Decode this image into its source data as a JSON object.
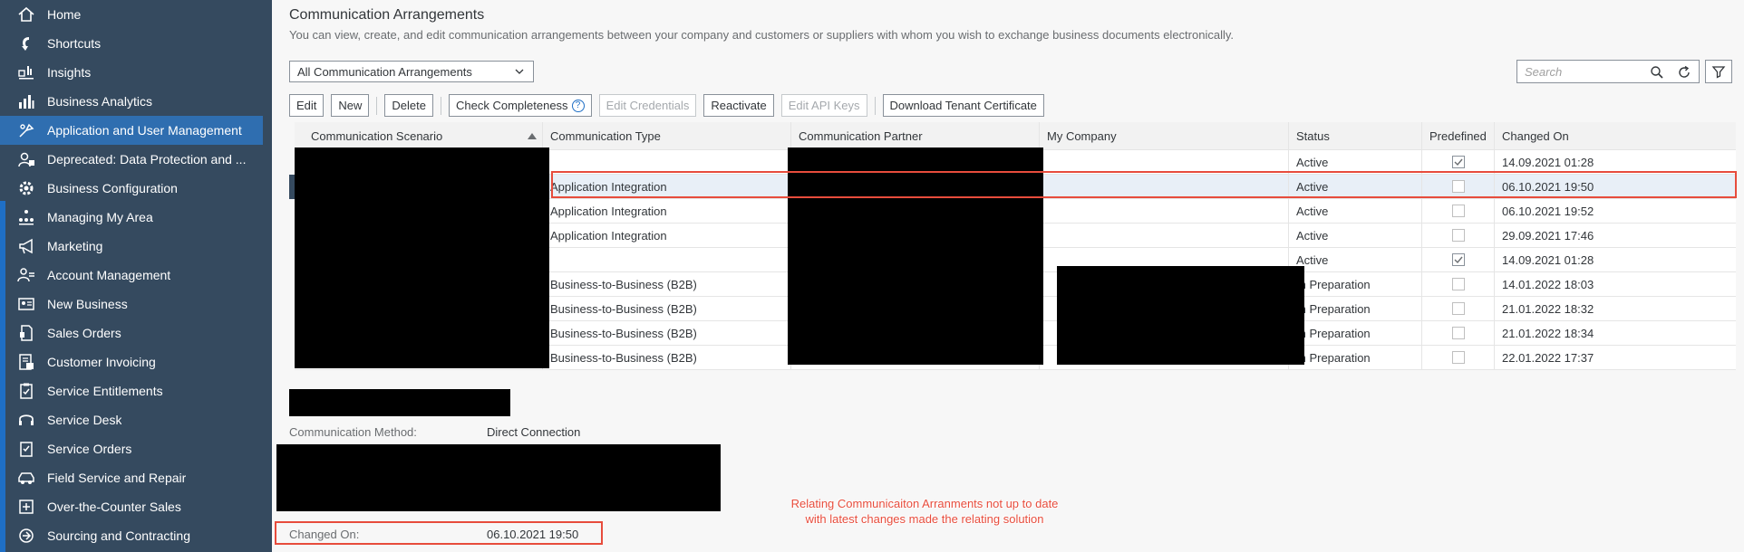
{
  "sidebar": {
    "items": [
      {
        "label": "Home",
        "icon": "home-icon"
      },
      {
        "label": "Shortcuts",
        "icon": "shortcut-icon"
      },
      {
        "label": "Insights",
        "icon": "insights-icon"
      },
      {
        "label": "Business Analytics",
        "icon": "bar-chart-icon"
      },
      {
        "label": "Application and User Management",
        "icon": "user-settings-icon",
        "selected": true
      },
      {
        "label": "Deprecated: Data Protection and ...",
        "icon": "data-protection-icon"
      },
      {
        "label": "Business Configuration",
        "icon": "gear-icon"
      },
      {
        "label": "Managing My Area",
        "icon": "org-chart-icon"
      },
      {
        "label": "Marketing",
        "icon": "megaphone-icon"
      },
      {
        "label": "Account Management",
        "icon": "account-icon"
      },
      {
        "label": "New Business",
        "icon": "business-card-icon"
      },
      {
        "label": "Sales Orders",
        "icon": "sales-order-icon"
      },
      {
        "label": "Customer Invoicing",
        "icon": "invoice-icon"
      },
      {
        "label": "Service Entitlements",
        "icon": "entitlement-icon"
      },
      {
        "label": "Service Desk",
        "icon": "headset-icon"
      },
      {
        "label": "Service Orders",
        "icon": "service-order-icon"
      },
      {
        "label": "Field Service and Repair",
        "icon": "car-icon"
      },
      {
        "label": "Over-the-Counter Sales",
        "icon": "counter-icon"
      },
      {
        "label": "Sourcing and Contracting",
        "icon": "sourcing-icon"
      }
    ]
  },
  "page": {
    "title": "Communication Arrangements",
    "description": "You can view, create, and edit communication arrangements between your company and customers or suppliers with whom you wish to exchange business documents electronically."
  },
  "filter": {
    "selected": "All Communication Arrangements"
  },
  "search": {
    "placeholder": "Search"
  },
  "toolbar": {
    "edit": "Edit",
    "new": "New",
    "delete": "Delete",
    "check_completeness": "Check Completeness",
    "edit_credentials": "Edit Credentials",
    "reactivate": "Reactivate",
    "edit_api_keys": "Edit API Keys",
    "download_cert": "Download Tenant Certificate"
  },
  "table": {
    "columns": [
      "Communication Scenario",
      "Communication Type",
      "Communication Partner",
      "My Company",
      "Status",
      "Predefined",
      "Changed On"
    ],
    "rows": [
      {
        "type": "",
        "status": "Active",
        "predefined": true,
        "changed": "14.09.2021 01:28"
      },
      {
        "type": "Application Integration",
        "status": "Active",
        "predefined": false,
        "changed": "06.10.2021 19:50"
      },
      {
        "type": "Application Integration",
        "status": "Active",
        "predefined": false,
        "changed": "06.10.2021 19:52"
      },
      {
        "type": "Application Integration",
        "status": "Active",
        "predefined": false,
        "changed": "29.09.2021 17:46"
      },
      {
        "type": "",
        "status": "Active",
        "predefined": true,
        "changed": "14.09.2021 01:28"
      },
      {
        "type": "Business-to-Business (B2B)",
        "status": "In Preparation",
        "predefined": false,
        "changed": "14.01.2022 18:03"
      },
      {
        "type": "Business-to-Business (B2B)",
        "status": "In Preparation",
        "predefined": false,
        "changed": "21.01.2022 18:32"
      },
      {
        "type": "Business-to-Business (B2B)",
        "status": "In Preparation",
        "predefined": false,
        "changed": "21.01.2022 18:34"
      },
      {
        "type": "Business-to-Business (B2B)",
        "status": "In Preparation",
        "predefined": false,
        "changed": "22.01.2022 17:37"
      }
    ]
  },
  "detail": {
    "method_label": "Communication Method:",
    "method_value": "Direct Connection",
    "changed_label": "Changed On:",
    "changed_value": "06.10.2021 19:50"
  },
  "annotation": {
    "line1": "Relating Communicaiton Arranments not up to date",
    "line2": "with latest changes made the relating solution",
    "color": "#e74c3c"
  }
}
